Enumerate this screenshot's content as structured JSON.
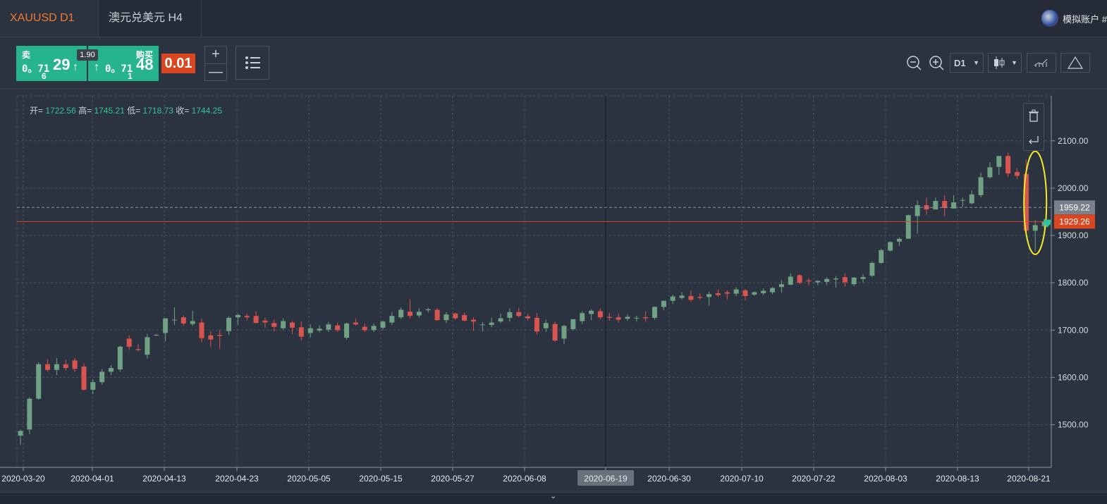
{
  "tabs": [
    {
      "label": "XAUUSD  D1",
      "active": true
    },
    {
      "label": "澳元兑美元 H4",
      "active": false
    }
  ],
  "account": {
    "label": "模拟账户 #"
  },
  "trade": {
    "sell_label": "卖",
    "sell_price_small": "0。71",
    "sell_price_big": "29",
    "sell_price_sub": "6",
    "buy_label": "购买",
    "buy_price_small": "0。71",
    "buy_price_big": "48",
    "buy_price_sub": "1",
    "arrow": "↑",
    "spread": "1.90",
    "lot": "0.01",
    "plus": "+",
    "minus": "—"
  },
  "toolbar": {
    "timeframe": "D1",
    "icons": [
      "zoom-out-icon",
      "zoom-in-icon",
      "candlestick-icon",
      "indicators-icon",
      "drawing-triangle-icon"
    ]
  },
  "ohlc": {
    "open_label": "开=",
    "open": "1722.56",
    "high_label": "高=",
    "high": "1745.21",
    "low_label": "低=",
    "low": "1718.73",
    "close_label": "收=",
    "close": "1744.25"
  },
  "colors": {
    "up": "#6fa184",
    "down": "#d9534f",
    "background": "#2c3340",
    "grid": "#4a5262",
    "price_line": "#d9461f",
    "highlight": "#f3ea2a",
    "accent": "#f07b31"
  },
  "chart_data": {
    "type": "candlestick",
    "y_ticks": [
      "2100.00",
      "2000.00",
      "1900.00",
      "1800.00",
      "1700.00",
      "1600.00",
      "1500.00"
    ],
    "x_ticks": [
      "2020-03-20",
      "2020-04-01",
      "2020-04-13",
      "2020-04-23",
      "2020-05-05",
      "2020-05-15",
      "2020-05-27",
      "2020-06-08",
      "2020-06-19",
      "2020-06-30",
      "2020-07-10",
      "2020-07-22",
      "2020-08-03",
      "2020-08-13",
      "2020-08-21"
    ],
    "ylim": [
      1410,
      2195
    ],
    "crosshair_date": "2020-06-19",
    "price_labels": [
      {
        "value": "1959.22",
        "style": "ask"
      },
      {
        "value": "1929.26",
        "style": "bid"
      }
    ],
    "candles": [
      [
        1477,
        1490,
        1457,
        1487
      ],
      [
        1490,
        1558,
        1480,
        1555
      ],
      [
        1555,
        1632,
        1553,
        1628
      ],
      [
        1628,
        1638,
        1612,
        1616
      ],
      [
        1616,
        1641,
        1605,
        1628
      ],
      [
        1628,
        1637,
        1615,
        1620
      ],
      [
        1636,
        1641,
        1612,
        1618
      ],
      [
        1623,
        1630,
        1572,
        1574
      ],
      [
        1574,
        1596,
        1565,
        1590
      ],
      [
        1590,
        1618,
        1585,
        1612
      ],
      [
        1612,
        1626,
        1605,
        1620
      ],
      [
        1617,
        1667,
        1612,
        1665
      ],
      [
        1682,
        1689,
        1658,
        1665
      ],
      [
        1660,
        1670,
        1655,
        1658
      ],
      [
        1648,
        1692,
        1640,
        1685
      ],
      [
        1689,
        1692,
        1688,
        1690
      ],
      [
        1694,
        1725,
        1676,
        1725
      ],
      [
        1722,
        1748,
        1711,
        1722
      ],
      [
        1727,
        1731,
        1709,
        1714
      ],
      [
        1713,
        1741,
        1709,
        1719
      ],
      [
        1716,
        1724,
        1674,
        1683
      ],
      [
        1689,
        1698,
        1664,
        1680
      ],
      [
        1690,
        1700,
        1660,
        1688
      ],
      [
        1698,
        1729,
        1690,
        1726
      ],
      [
        1727,
        1735,
        1711,
        1732
      ],
      [
        1730,
        1735,
        1721,
        1727
      ],
      [
        1730,
        1740,
        1715,
        1715
      ],
      [
        1720,
        1727,
        1705,
        1716
      ],
      [
        1715,
        1722,
        1697,
        1707
      ],
      [
        1704,
        1725,
        1700,
        1719
      ],
      [
        1716,
        1719,
        1692,
        1705
      ],
      [
        1706,
        1718,
        1678,
        1686
      ],
      [
        1694,
        1712,
        1684,
        1704
      ],
      [
        1699,
        1710,
        1695,
        1703
      ],
      [
        1701,
        1717,
        1696,
        1712
      ],
      [
        1710,
        1716,
        1696,
        1700
      ],
      [
        1684,
        1716,
        1680,
        1714
      ],
      [
        1716,
        1725,
        1709,
        1712
      ],
      [
        1707,
        1714,
        1696,
        1700
      ],
      [
        1700,
        1714,
        1696,
        1709
      ],
      [
        1705,
        1720,
        1701,
        1718
      ],
      [
        1716,
        1738,
        1711,
        1730
      ],
      [
        1727,
        1748,
        1723,
        1743
      ],
      [
        1739,
        1765,
        1725,
        1730
      ],
      [
        1731,
        1746,
        1726,
        1739
      ],
      [
        1742,
        1747,
        1737,
        1744
      ],
      [
        1743,
        1747,
        1720,
        1721
      ],
      [
        1721,
        1738,
        1715,
        1733
      ],
      [
        1735,
        1737,
        1722,
        1725
      ],
      [
        1732,
        1737,
        1718,
        1720
      ],
      [
        1722,
        1727,
        1698,
        1718
      ],
      [
        1712,
        1717,
        1697,
        1712
      ],
      [
        1711,
        1726,
        1706,
        1716
      ],
      [
        1718,
        1735,
        1715,
        1725
      ],
      [
        1726,
        1746,
        1718,
        1738
      ],
      [
        1738,
        1747,
        1727,
        1730
      ],
      [
        1729,
        1734,
        1720,
        1725
      ],
      [
        1726,
        1736,
        1691,
        1697
      ],
      [
        1704,
        1722,
        1696,
        1715
      ],
      [
        1713,
        1718,
        1675,
        1678
      ],
      [
        1682,
        1711,
        1671,
        1709
      ],
      [
        1702,
        1723,
        1699,
        1723
      ],
      [
        1719,
        1740,
        1713,
        1736
      ],
      [
        1734,
        1744,
        1721,
        1741
      ],
      [
        1740,
        1746,
        1723,
        1727
      ],
      [
        1728,
        1736,
        1720,
        1726
      ],
      [
        1727,
        1735,
        1716,
        1722
      ],
      [
        1724,
        1733,
        1720,
        1728
      ],
      [
        1725,
        1730,
        1718,
        1726
      ],
      [
        1727,
        1740,
        1718,
        1725
      ],
      [
        1726,
        1750,
        1722,
        1749
      ],
      [
        1749,
        1762,
        1742,
        1762
      ],
      [
        1762,
        1775,
        1755,
        1771
      ],
      [
        1768,
        1780,
        1765,
        1773
      ],
      [
        1772,
        1784,
        1760,
        1764
      ],
      [
        1770,
        1777,
        1765,
        1768
      ],
      [
        1770,
        1781,
        1752,
        1776
      ],
      [
        1778,
        1786,
        1770,
        1774
      ],
      [
        1780,
        1784,
        1765,
        1777
      ],
      [
        1777,
        1791,
        1772,
        1786
      ],
      [
        1784,
        1787,
        1763,
        1772
      ],
      [
        1775,
        1782,
        1772,
        1780
      ],
      [
        1778,
        1788,
        1774,
        1783
      ],
      [
        1780,
        1791,
        1776,
        1789
      ],
      [
        1791,
        1806,
        1779,
        1797
      ],
      [
        1796,
        1820,
        1795,
        1813
      ],
      [
        1816,
        1818,
        1797,
        1800
      ],
      [
        1805,
        1810,
        1795,
        1803
      ],
      [
        1801,
        1805,
        1795,
        1804
      ],
      [
        1802,
        1812,
        1795,
        1808
      ],
      [
        1807,
        1814,
        1790,
        1809
      ],
      [
        1812,
        1820,
        1792,
        1801
      ],
      [
        1797,
        1812,
        1793,
        1811
      ],
      [
        1808,
        1818,
        1800,
        1812
      ],
      [
        1815,
        1845,
        1812,
        1842
      ],
      [
        1842,
        1872,
        1840,
        1869
      ],
      [
        1868,
        1888,
        1866,
        1886
      ],
      [
        1887,
        1896,
        1878,
        1893
      ],
      [
        1893,
        1944,
        1902,
        1943
      ],
      [
        1941,
        1974,
        1904,
        1964
      ],
      [
        1964,
        1980,
        1944,
        1955
      ],
      [
        1955,
        1980,
        1955,
        1973
      ],
      [
        1973,
        1985,
        1940,
        1958
      ],
      [
        1957,
        1985,
        1957,
        1970
      ],
      [
        1975,
        1980,
        1961,
        1975
      ],
      [
        1968,
        1995,
        1966,
        1987
      ],
      [
        1985,
        2033,
        1980,
        2023
      ],
      [
        2023,
        2055,
        2020,
        2044
      ],
      [
        2045,
        2064,
        2028,
        2068
      ],
      [
        2068,
        2075,
        2024,
        2031
      ],
      [
        2034,
        2042,
        2019,
        2026
      ],
      [
        2030,
        2060,
        1904,
        1910
      ],
      [
        1910,
        1932,
        1866,
        1922
      ],
      [
        1920,
        1935,
        1915,
        1929
      ]
    ]
  }
}
